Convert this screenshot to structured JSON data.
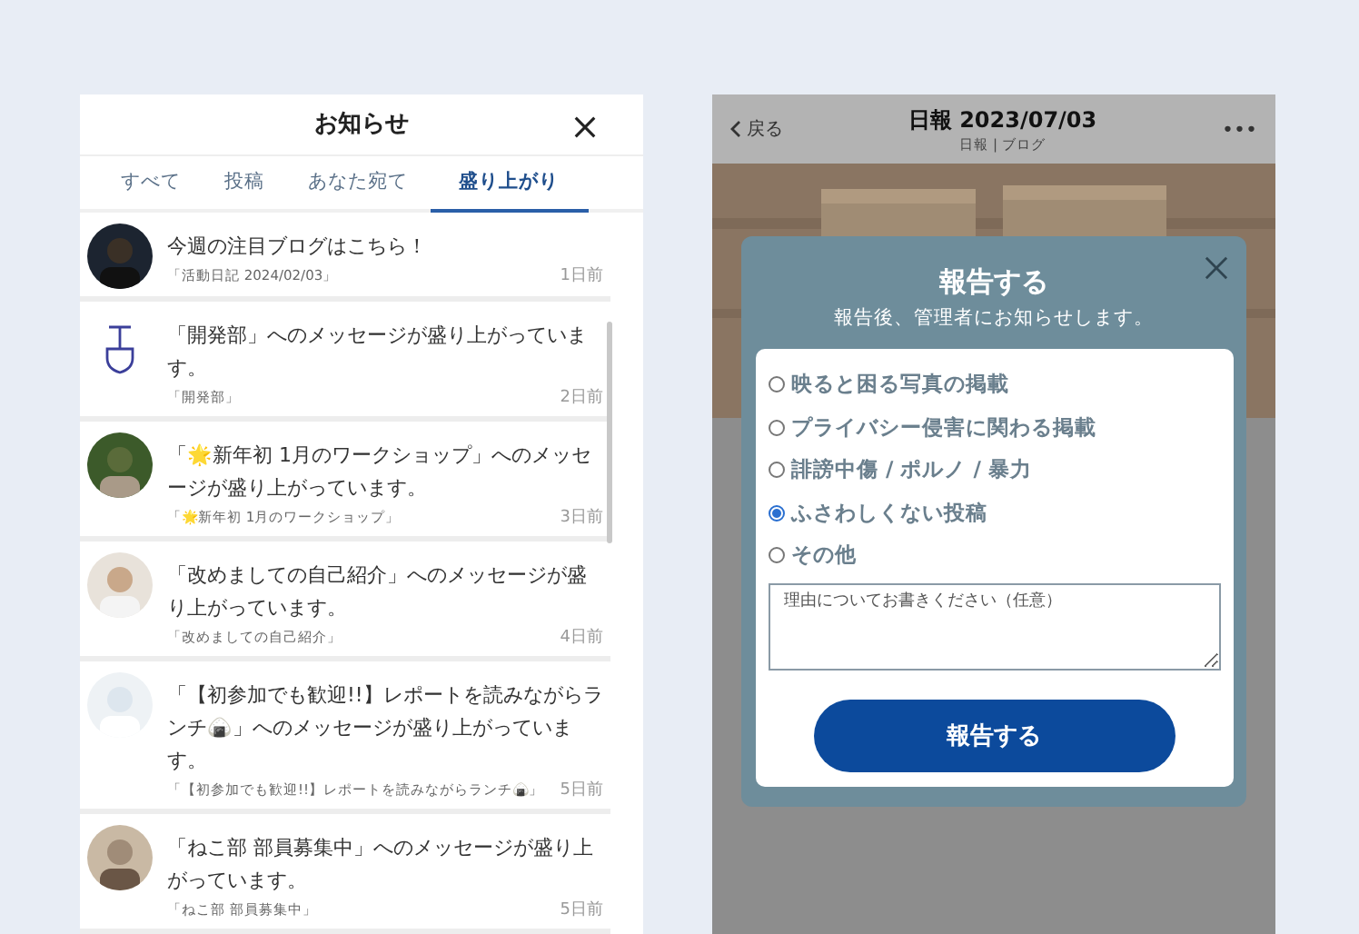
{
  "notifications": {
    "title": "お知らせ",
    "tabs": [
      {
        "label": "すべて",
        "selected": false
      },
      {
        "label": "投稿",
        "selected": false
      },
      {
        "label": "あなた宛て",
        "selected": false
      },
      {
        "label": "盛り上がり",
        "selected": true
      }
    ],
    "items": [
      {
        "kind": "picture",
        "text": "今週の注目ブログはこちら！",
        "source": "「活動日記 2024/02/03」",
        "time": "1日前"
      },
      {
        "kind": "icon",
        "text": "「開発部」へのメッセージが盛り上がっています。",
        "source": "「開発部」",
        "time": "2日前"
      },
      {
        "kind": "picture",
        "text": "「🌟新年初 1月のワークショップ」へのメッセージが盛り上がっています。",
        "source": "「🌟新年初 1月のワークショップ」",
        "time": "3日前"
      },
      {
        "kind": "picture",
        "text": "「改めましての自己紹介」へのメッセージが盛り上がっています。",
        "source": "「改めましての自己紹介」",
        "time": "4日前"
      },
      {
        "kind": "picture",
        "text": "「【初参加でも歓迎!!】レポートを読みながらランチ🍙」へのメッセージが盛り上がっています。",
        "source": "「【初参加でも歓迎!!】レポートを読みながらランチ🍙」",
        "time": "5日前"
      },
      {
        "kind": "picture",
        "text": "「ねこ部 部員募集中」へのメッセージが盛り上がっています。",
        "source": "「ねこ部 部員募集中」",
        "time": "5日前"
      }
    ]
  },
  "post": {
    "back": "戻る",
    "title": "日報 2023/07/03",
    "subtitle": "日報 | ブログ",
    "more": "•••"
  },
  "report_dialog": {
    "title": "報告する",
    "subtitle": "報告後、管理者にお知らせします。",
    "options": [
      {
        "label": "映ると困る写真の掲載",
        "selected": false
      },
      {
        "label": "プライバシー侵害に関わる掲載",
        "selected": false
      },
      {
        "label": "誹謗中傷 / ポルノ / 暴力",
        "selected": false
      },
      {
        "label": "ふさわしくない投稿",
        "selected": true
      },
      {
        "label": "その他",
        "selected": false
      }
    ],
    "reason": {
      "placeholder": "理由についてお書きください（任意）"
    },
    "submit": "報告する"
  }
}
